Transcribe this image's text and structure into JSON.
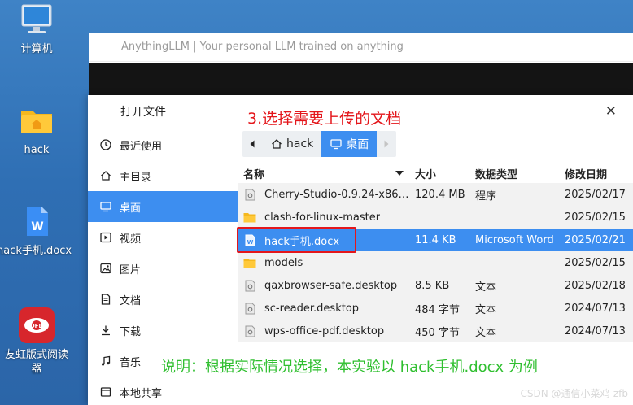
{
  "desktop": {
    "icons": [
      {
        "label": "计算机",
        "icon": "computer-icon"
      },
      {
        "label": "hack",
        "icon": "home-folder-icon"
      },
      {
        "label": "hack手机.docx",
        "icon": "word-document-icon"
      },
      {
        "label": "友虹版式阅读器",
        "icon": "reader-app-icon"
      }
    ]
  },
  "app_window": {
    "title": "AnythingLLM | Your personal LLM trained on anything"
  },
  "dialog": {
    "title": "打开文件",
    "close_symbol": "✕",
    "sidebar": [
      {
        "label": "最近使用",
        "icon": "clock-icon"
      },
      {
        "label": "主目录",
        "icon": "home-icon"
      },
      {
        "label": "桌面",
        "icon": "desktop-icon",
        "active": true
      },
      {
        "label": "视频",
        "icon": "video-icon"
      },
      {
        "label": "图片",
        "icon": "image-icon"
      },
      {
        "label": "文档",
        "icon": "document-icon"
      },
      {
        "label": "下载",
        "icon": "download-icon"
      },
      {
        "label": "音乐",
        "icon": "music-icon"
      },
      {
        "label": "本地共享",
        "icon": "share-icon"
      }
    ],
    "breadcrumbs": [
      {
        "label": "hack",
        "icon": "home-icon"
      },
      {
        "label": "桌面",
        "icon": "desktop-icon",
        "active": true
      }
    ],
    "columns": {
      "name": "名称",
      "size": "大小",
      "type": "数据类型",
      "date": "修改日期"
    },
    "files": [
      {
        "name": "Cherry-Studio-0.9.24-x86_…",
        "size": "120.4 MB",
        "type": "程序",
        "date": "2025/02/17",
        "icon": "executable-icon"
      },
      {
        "name": "clash-for-linux-master",
        "size": "",
        "type": "",
        "date": "2025/02/15",
        "icon": "folder-icon"
      },
      {
        "name": "hack手机.docx",
        "size": "11.4 KB",
        "type": "Microsoft Word",
        "date": "2025/02/21",
        "icon": "word-document-icon",
        "selected": true
      },
      {
        "name": "models",
        "size": "",
        "type": "",
        "date": "2025/02/15",
        "icon": "folder-icon"
      },
      {
        "name": "qaxbrowser-safe.desktop",
        "size": "8.5 KB",
        "type": "文本",
        "date": "2025/02/18",
        "icon": "text-file-icon"
      },
      {
        "name": "sc-reader.desktop",
        "size": "484 字节",
        "type": "文本",
        "date": "2024/07/13",
        "icon": "text-file-icon"
      },
      {
        "name": "wps-office-pdf.desktop",
        "size": "450 字节",
        "type": "文本",
        "date": "2024/07/13",
        "icon": "text-file-icon"
      }
    ]
  },
  "annotations": {
    "step": "3.选择需要上传的文档",
    "note": "说明：根据实际情况选择，本实验以 hack手机.docx 为例"
  },
  "watermark": "CSDN @通信小菜鸡-zfb",
  "colors": {
    "accent": "#3d8ef0",
    "annotation_red": "#e4161b",
    "annotation_green": "#2fbf2f",
    "desktop_blue": "#2f6fb4"
  }
}
